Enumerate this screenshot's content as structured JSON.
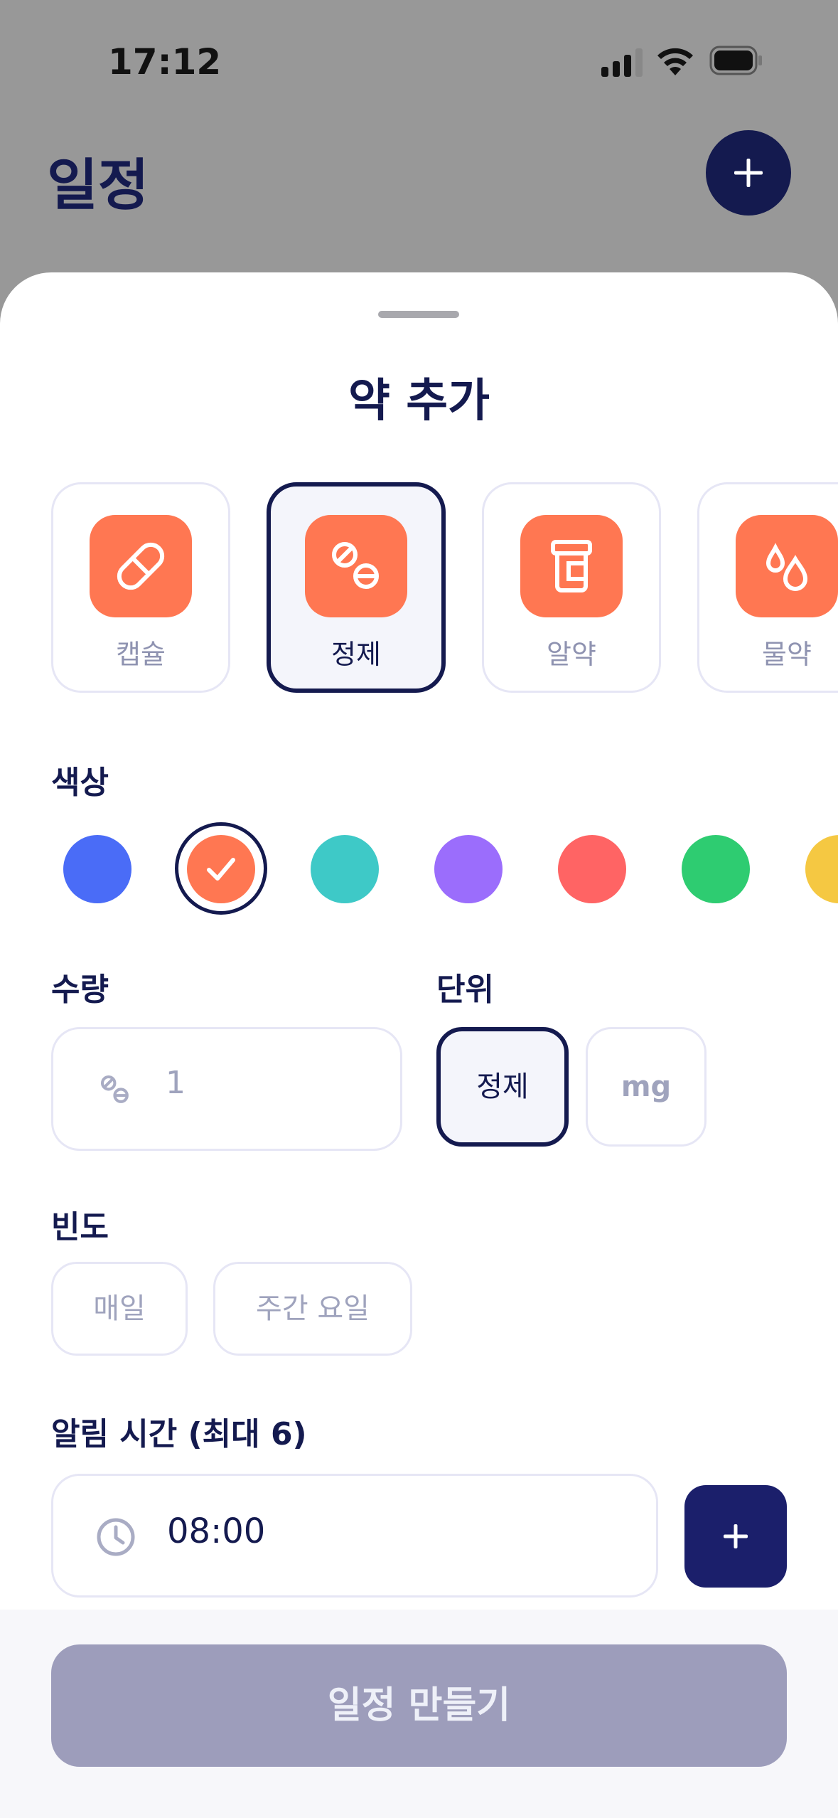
{
  "status_bar": {
    "time": "17:12"
  },
  "page": {
    "title": "일정"
  },
  "sheet": {
    "title": "약 추가",
    "types": [
      {
        "label": "캡슐",
        "icon": "capsule-icon"
      },
      {
        "label": "정제",
        "icon": "tablet-icon",
        "selected": true
      },
      {
        "label": "알약",
        "icon": "pill-bottle-icon"
      },
      {
        "label": "물약",
        "icon": "liquid-drops-icon"
      }
    ],
    "color_label": "색상",
    "colors": [
      "#4a6cf7",
      "#ff7752",
      "#3ec9c7",
      "#9b6dfc",
      "#ff6464",
      "#2ecc71",
      "#f5c842"
    ],
    "selected_color": "#ff7752",
    "quantity_label": "수량",
    "quantity_value": "1",
    "unit_label": "단위",
    "units": [
      "정제",
      "mg"
    ],
    "selected_unit": "정제",
    "frequency_label": "빈도",
    "frequencies": [
      "매일",
      "주간 요일"
    ],
    "alarm_label": "알림 시간 (최대 6)",
    "alarm_time": "08:00",
    "create_button": "일정 만들기"
  }
}
